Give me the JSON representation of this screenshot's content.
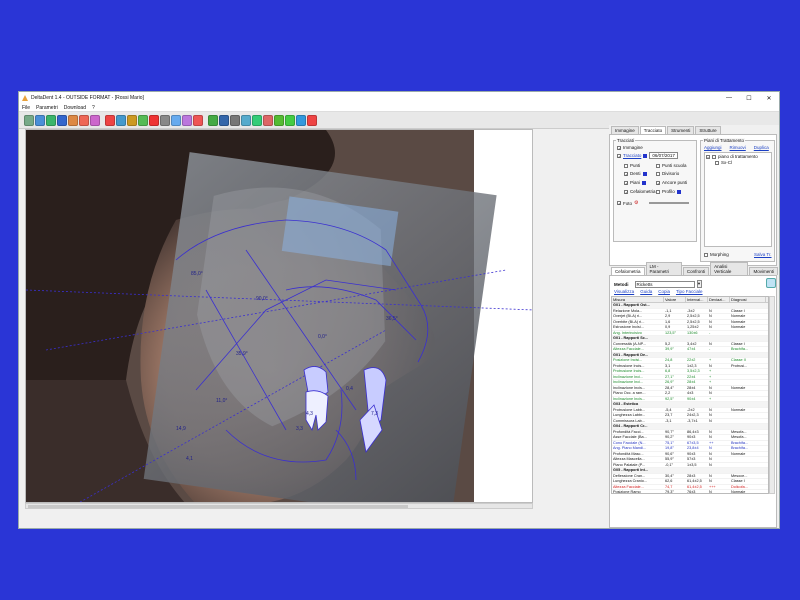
{
  "window": {
    "title": "DeltaDent 1.4 - OUTSIDE FORMAT - [Rossi Mario]",
    "minimize_glyph": "—",
    "maximize_glyph": "☐",
    "close_glyph": "✕"
  },
  "menu": [
    "File",
    "Parametri",
    "Download",
    "?"
  ],
  "toolbar_icons": [
    "open-icon",
    "save-icon",
    "undo-icon",
    "redo-icon",
    "rotate-icon",
    "flip-icon",
    "crop-icon",
    "brightness-icon",
    "contrast-icon",
    "color-icon",
    "filter-icon",
    "zoom-icon",
    "measure-icon",
    "grid-icon",
    "tooth-icon",
    "lips-icon",
    "profile-icon",
    "layer-icon",
    "print-icon",
    "export-icon",
    "report-icon",
    "compare-icon",
    "check-icon",
    "confirm-icon",
    "settings-icon",
    "exit-icon"
  ],
  "viewer": {
    "labels": [
      "90,0°",
      "36,5°",
      "11,0°",
      "0,0°",
      "35,9°",
      "85,0°",
      "4,3",
      "7,3",
      "0,4",
      "4,1",
      "3,3",
      "14,9"
    ]
  },
  "right_tabs": [
    "Immagine",
    "Tracciato",
    "Strumenti",
    "Strutture"
  ],
  "tracciati": {
    "title": "Tracciati",
    "immagine": "Immagine",
    "tracciato": "Tracciato",
    "date": "06/07/2017",
    "punti": "Punti",
    "punti_scuola": "Punti scuola",
    "denti": "Denti",
    "divisorio": "Divisorio",
    "piani": "Piani",
    "ancore": "Ancore punti",
    "cefalometria": "Cefalometria",
    "profilo": "Profilo",
    "foto": "Foto"
  },
  "piani_trattamento": {
    "title": "Piani di Trattamento",
    "aggiungi": "Aggiungi",
    "rimuovi": "Rimuovi",
    "duplica": "Duplica",
    "tree_root": "piano di trattamento",
    "tree_child": "Sx-Cl",
    "morphing": "Morphing",
    "salva": "Salva Tr."
  },
  "ceph_tabs": [
    "Cefalometria",
    "LM - Parametri",
    "Confronti",
    "Analisi Verticale",
    "Movimenti"
  ],
  "metodi": {
    "label": "Metodi",
    "value": "Ricketts",
    "links": [
      "Visualizza",
      "Guida",
      "Copia",
      "Tipo Facciale"
    ]
  },
  "table": {
    "headers": [
      "Misura",
      "Valore",
      "Interval...",
      "Deviazi...",
      "Diagnosi"
    ],
    "rows": [
      {
        "cls": "sec",
        "c": [
          "G01 - Rapporti Ost...",
          "",
          "",
          "",
          ""
        ]
      },
      {
        "cls": "",
        "c": [
          "Relazione Mola...",
          "-1,1",
          "-3±2",
          "N",
          "Classe I"
        ]
      },
      {
        "cls": "",
        "c": [
          "Overjet (Bi-A) ri...",
          "2,9",
          "2,5±2,5",
          "N",
          "Normale"
        ]
      },
      {
        "cls": "",
        "c": [
          "Overbite (Bi-A) ri...",
          "1,6",
          "2,5±2,5",
          "N",
          "Normale"
        ]
      },
      {
        "cls": "",
        "c": [
          "Estrusione Incisi...",
          "0,9",
          "1,25±2",
          "N",
          "Normale"
        ]
      },
      {
        "cls": "green",
        "c": [
          "Ang. Interincisivo",
          "123,5°",
          "130±6",
          "-",
          ""
        ]
      },
      {
        "cls": "sec",
        "c": [
          "G01 - Rapporti Sc...",
          "",
          "",
          "",
          ""
        ]
      },
      {
        "cls": "",
        "c": [
          "Convessità (A-NP...",
          "5,2",
          "3,4±2",
          "N",
          "Classe I"
        ]
      },
      {
        "cls": "green",
        "c": [
          "Altezza Facciale...",
          "39,9°",
          "47±4",
          "-",
          "Brachifa..."
        ]
      },
      {
        "cls": "sec",
        "c": [
          "G01 - Rapporti De...",
          "",
          "",
          "",
          ""
        ]
      },
      {
        "cls": "green",
        "c": [
          "Posizione Incisi...",
          "24,8",
          "22±2",
          "+",
          "Classe II"
        ]
      },
      {
        "cls": "",
        "c": [
          "Protrusione Incis...",
          "3,1",
          "1±2,3",
          "N",
          "Protrusi..."
        ]
      },
      {
        "cls": "green",
        "c": [
          "Protrusione Incis...",
          "6,8",
          "3,5±2,3",
          "+",
          ""
        ]
      },
      {
        "cls": "green",
        "c": [
          "Inclinazione Inci...",
          "27,1°",
          "22±4",
          "+",
          ""
        ]
      },
      {
        "cls": "green",
        "c": [
          "Inclinazione Inci...",
          "26,9°",
          "28±4",
          "+",
          ""
        ]
      },
      {
        "cls": "",
        "c": [
          "Inclinazione Incis...",
          "28,4°",
          "28±4",
          "N",
          "Normale"
        ]
      },
      {
        "cls": "",
        "c": [
          "Piano Occ. a ram...",
          "2,2",
          "4±3",
          "N",
          ""
        ]
      },
      {
        "cls": "green",
        "c": [
          "Inclinazione Incis...",
          "92,5°",
          "90±4",
          "+",
          ""
        ]
      },
      {
        "cls": "sec",
        "c": [
          "G03 - Estetica",
          "",
          "",
          "",
          ""
        ]
      },
      {
        "cls": "",
        "c": [
          "Protrusione Labb...",
          "-5,4",
          "-2±2",
          "N",
          "Normale"
        ]
      },
      {
        "cls": "",
        "c": [
          "Lunghezza Labbr...",
          "23,7",
          "24±2,3",
          "N",
          ""
        ]
      },
      {
        "cls": "",
        "c": [
          "Commissura Lab...",
          "-3,1",
          "-3,7±1",
          "N",
          ""
        ]
      },
      {
        "cls": "sec",
        "c": [
          "G04 - Rapporti Cr...",
          "",
          "",
          "",
          ""
        ]
      },
      {
        "cls": "",
        "c": [
          "Profondità Facci...",
          "90,7°",
          "86,4±3",
          "N",
          "Mesofa..."
        ]
      },
      {
        "cls": "",
        "c": [
          "Asse Facciale (Ba...",
          "90,2°",
          "90±3",
          "N",
          "Mesofa..."
        ]
      },
      {
        "cls": "blue",
        "c": [
          "Cono Facciale (N...",
          "75,1°",
          "67±3,5",
          "++",
          "Brachifa..."
        ]
      },
      {
        "cls": "blue",
        "c": [
          "Ang. Piano Mandi...",
          "19,8°",
          "23,8±4",
          "N",
          "Brachifa..."
        ]
      },
      {
        "cls": "",
        "c": [
          "Profondità Masc...",
          "90,6°",
          "90±3",
          "N",
          "Normale"
        ]
      },
      {
        "cls": "",
        "c": [
          "Altezza Mascella...",
          "55,9°",
          "57±3",
          "N",
          ""
        ]
      },
      {
        "cls": "",
        "c": [
          "Piano Palatale (P...",
          "-0,1°",
          "1±3,5",
          "N",
          ""
        ]
      },
      {
        "cls": "sec",
        "c": [
          "G05 - Rapporti Int...",
          "",
          "",
          "",
          ""
        ]
      },
      {
        "cls": "",
        "c": [
          "Deflessione Cran...",
          "30,4°",
          "28±3",
          "N",
          "Mesoce..."
        ]
      },
      {
        "cls": "",
        "c": [
          "Lunghezza Cranio...",
          "62,6",
          "61,4±2,5",
          "N",
          "Classe I"
        ]
      },
      {
        "cls": "red",
        "c": [
          "Altezza Facciale...",
          "74,7",
          "61,4±2,5",
          "+++",
          "Dolicofa..."
        ]
      },
      {
        "cls": "",
        "c": [
          "Posizione Ramo",
          "79,3°",
          "76±3",
          "N",
          "Normale"
        ]
      }
    ]
  }
}
